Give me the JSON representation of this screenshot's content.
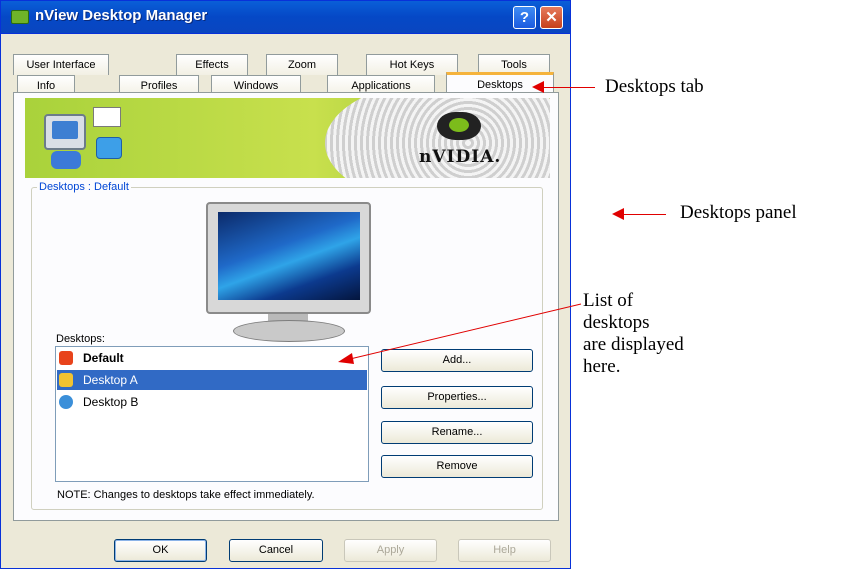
{
  "window": {
    "title": "nView Desktop Manager",
    "help_button": "?",
    "close_button": "✕"
  },
  "tabs_top": [
    "User Interface",
    "Effects",
    "Zoom",
    "Hot Keys",
    "Tools"
  ],
  "tabs_bottom": [
    "Info",
    "Profiles",
    "Windows",
    "Applications",
    "Desktops"
  ],
  "banner": {
    "brand_text": "nVIDIA."
  },
  "group": {
    "label": "Desktops : Default",
    "list_label": "Desktops:",
    "items": [
      {
        "label": "Default",
        "icon": "power-icon",
        "color": "#e8431b",
        "selected": false,
        "bold": true
      },
      {
        "label": "Desktop A",
        "icon": "desktop-grid-icon",
        "color": "#f1c232",
        "selected": true,
        "bold": false
      },
      {
        "label": "Desktop B",
        "icon": "globe-icon",
        "color": "#3b8fd9",
        "selected": false,
        "bold": false
      }
    ],
    "buttons": {
      "add": "Add...",
      "properties": "Properties...",
      "rename": "Rename...",
      "remove": "Remove"
    },
    "note": "NOTE: Changes to desktops take effect immediately."
  },
  "footer": {
    "ok": "OK",
    "cancel": "Cancel",
    "apply": "Apply",
    "help": "Help"
  },
  "annotations": {
    "desktops_tab": "Desktops tab",
    "desktops_panel": "Desktops panel",
    "list_line1": "List of",
    "list_line2": "desktops",
    "list_line3": "are displayed",
    "list_line4": "here."
  },
  "colors": {
    "accent": "#0a5fd8",
    "arrow": "#e00000",
    "selection": "#316ac5",
    "tab_highlight": "#f5b33c"
  }
}
